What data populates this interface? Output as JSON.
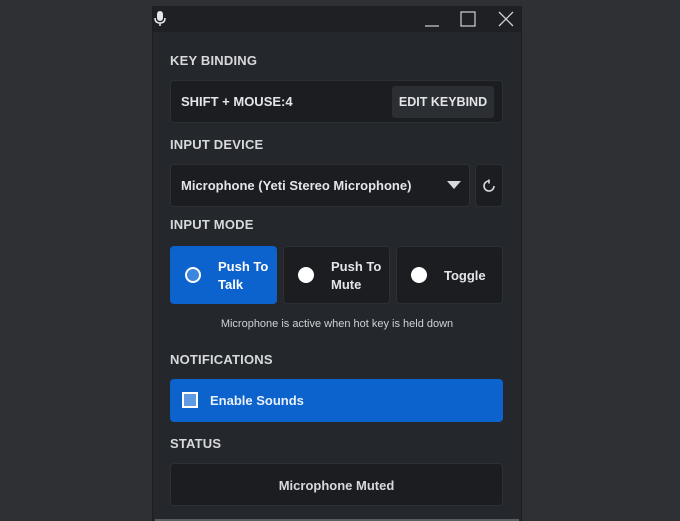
{
  "titlebar": {
    "mic_icon": "microphone-icon",
    "minimize_icon": "minimize-icon",
    "maximize_icon": "maximize-icon",
    "close_icon": "close-icon"
  },
  "key_binding": {
    "label": "KEY BINDING",
    "value": "SHIFT + MOUSE:4",
    "edit_button": "EDIT KEYBIND"
  },
  "input_device": {
    "label": "INPUT DEVICE",
    "selected": "Microphone (Yeti Stereo Microphone)",
    "refresh_icon": "refresh-icon"
  },
  "input_mode": {
    "label": "INPUT MODE",
    "options": [
      {
        "label": "Push To Talk",
        "selected": true
      },
      {
        "label": "Push To Mute",
        "selected": false
      },
      {
        "label": "Toggle",
        "selected": false
      }
    ],
    "hint": "Microphone is active when hot key is held down"
  },
  "notifications": {
    "label": "NOTIFICATIONS",
    "enable_sounds": "Enable Sounds",
    "enable_sounds_checked": true
  },
  "status": {
    "label": "STATUS",
    "value": "Microphone Muted"
  },
  "colors": {
    "accent": "#0c63ce",
    "background": "#24272b",
    "panel": "#1b1d20"
  }
}
